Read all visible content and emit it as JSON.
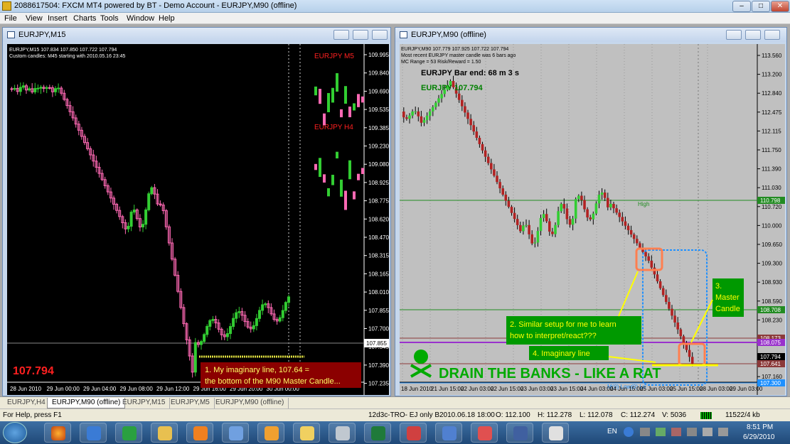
{
  "app": {
    "title": "2088617504: FXCM MT4 powered by BT - Demo Account - EURJPY,M90 (offline)",
    "title_controls": [
      "–",
      "□",
      "✕"
    ]
  },
  "menu": [
    "File",
    "View",
    "Insert",
    "Charts",
    "Tools",
    "Window",
    "Help"
  ],
  "left_chart": {
    "window_title": "EURJPY,M15",
    "info_line1": "EURJPY,M15  107.834 107.850 107.722 107.794",
    "info_line2": "Custom candles: M45 starting with 2010.05.16 23:45",
    "overlay_m5": "EURJPY M5",
    "overlay_h4": "EURJPY H4",
    "big_price": "107.794",
    "bid_label": "107.855",
    "note": "1. My imaginary line, 107.64 = the bottom of the M90 Master Candle...",
    "y_ticks": [
      "109.995",
      "109.840",
      "109.690",
      "109.535",
      "109.385",
      "109.230",
      "109.080",
      "108.925",
      "108.775",
      "108.620",
      "108.470",
      "108.315",
      "108.165",
      "108.010",
      "107.855",
      "107.700",
      "107.545",
      "107.390",
      "107.235"
    ],
    "x_ticks": [
      "28 Jun 2010",
      "29 Jun 00:00",
      "29 Jun 04:00",
      "29 Jun 08:00",
      "29 Jun 12:00",
      "29 Jun 16:00",
      "29 Jun 20:00",
      "30 Jun 00:00"
    ],
    "colors": {
      "bg": "#000000",
      "bull": "#32cd32",
      "bear": "#ff69b4",
      "text": "#ffffff",
      "red": "#ff2020"
    }
  },
  "right_chart": {
    "window_title": "EURJPY,M90 (offline)",
    "info_line1": "EURJPY,M90  107.779 107.925 107.722 107.794",
    "info_line2": "Most recent EURJPY master candle was 6 bars ago",
    "info_line3": "MC Range = 53  Risk/Reward = 1.50",
    "bar_end": "EURJPY Bar end: 68 m 3 s",
    "price_label": "EURJPY 107.794",
    "high_label": "High",
    "low_label": "M(0) Low(0) Lo",
    "annot2": "2. Similar setup for me to learn how to interpret/react???",
    "annot3": "3. Master Candle",
    "annot4": "4. Imaginary line",
    "slogan": "DRAIN THE BANKS - LIKE A RAT",
    "y_ticks": [
      "113.560",
      "113.200",
      "112.840",
      "112.475",
      "112.115",
      "111.750",
      "111.390",
      "111.030",
      "110.720",
      "110.000",
      "109.650",
      "109.300",
      "108.930",
      "108.590",
      "108.230",
      "107.860",
      "107.520",
      "107.160"
    ],
    "price_tags": [
      {
        "text": "110.798",
        "color": "#228b22"
      },
      {
        "text": "108.708",
        "color": "#228b22"
      },
      {
        "text": "108.173",
        "color": "#8b3a3a"
      },
      {
        "text": "108.075",
        "color": "#9932cc"
      },
      {
        "text": "107.794",
        "color": "#000000"
      },
      {
        "text": "107.641",
        "color": "#8b3a3a"
      },
      {
        "text": "107.300",
        "color": "#1e90ff"
      }
    ],
    "x_ticks": [
      "18 Jun 2010",
      "21 Jun 15:00",
      "22 Jun 03:00",
      "22 Jun 15:00",
      "23 Jun 03:00",
      "23 Jun 15:00",
      "24 Jun 03:00",
      "24 Jun 15:00",
      "25 Jun 03:00",
      "25 Jun 15:00",
      "28 Jun 03:00",
      "29 Jun 03:00"
    ],
    "colors": {
      "bg": "#c0c0c0",
      "bull": "#32cd32",
      "bear": "#b22222",
      "note_bg": "#009900",
      "note_fg": "#ffff00"
    }
  },
  "tabs": [
    "EURJPY,H4",
    "EURJPY,M90 (offline)",
    "EURJPY,M15",
    "EURJPY,M5",
    "EURJPY,M90 (offline)"
  ],
  "status": {
    "help": "For Help, press F1",
    "profile": "12d3c-TRO- EJ only B",
    "datetime": "2010.06.18 18:00",
    "open": "O: 112.100",
    "high": "H: 112.278",
    "low": "L: 112.078",
    "close": "C: 112.274",
    "volume": "V: 5036",
    "traffic": "11522/4 kb"
  },
  "taskbar": {
    "lang": "EN",
    "time": "8:51 PM",
    "date": "6/29/2010"
  }
}
